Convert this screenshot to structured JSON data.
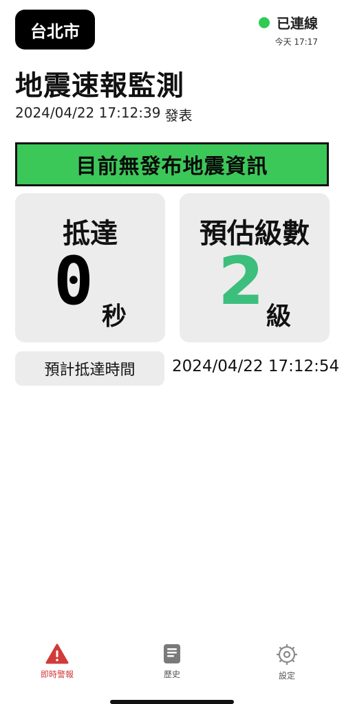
{
  "header": {
    "location": "台北市",
    "connection_status": "已連線",
    "connection_color": "#2ecc52",
    "connection_time": "今天 17:17"
  },
  "main": {
    "title": "地震速報監測",
    "issued_time": "2024/04/22 17:12:39",
    "issued_suffix": "發表",
    "banner_text": "目前無發布地震資訊",
    "banner_color": "#3cc859",
    "arrival": {
      "label": "抵達",
      "value": "0",
      "unit": "秒"
    },
    "intensity": {
      "label": "預估級數",
      "value": "2",
      "unit": "級",
      "color": "#3cbe7c"
    },
    "eta_label": "預計抵達時間",
    "eta_value": "2024/04/22 17:12:54"
  },
  "tabbar": {
    "tabs": [
      {
        "label": "即時警報",
        "icon": "warning-icon",
        "active": true,
        "color": "#d13b3b"
      },
      {
        "label": "歷史",
        "icon": "document-icon",
        "active": false
      },
      {
        "label": "設定",
        "icon": "gear-icon",
        "active": false
      }
    ]
  }
}
